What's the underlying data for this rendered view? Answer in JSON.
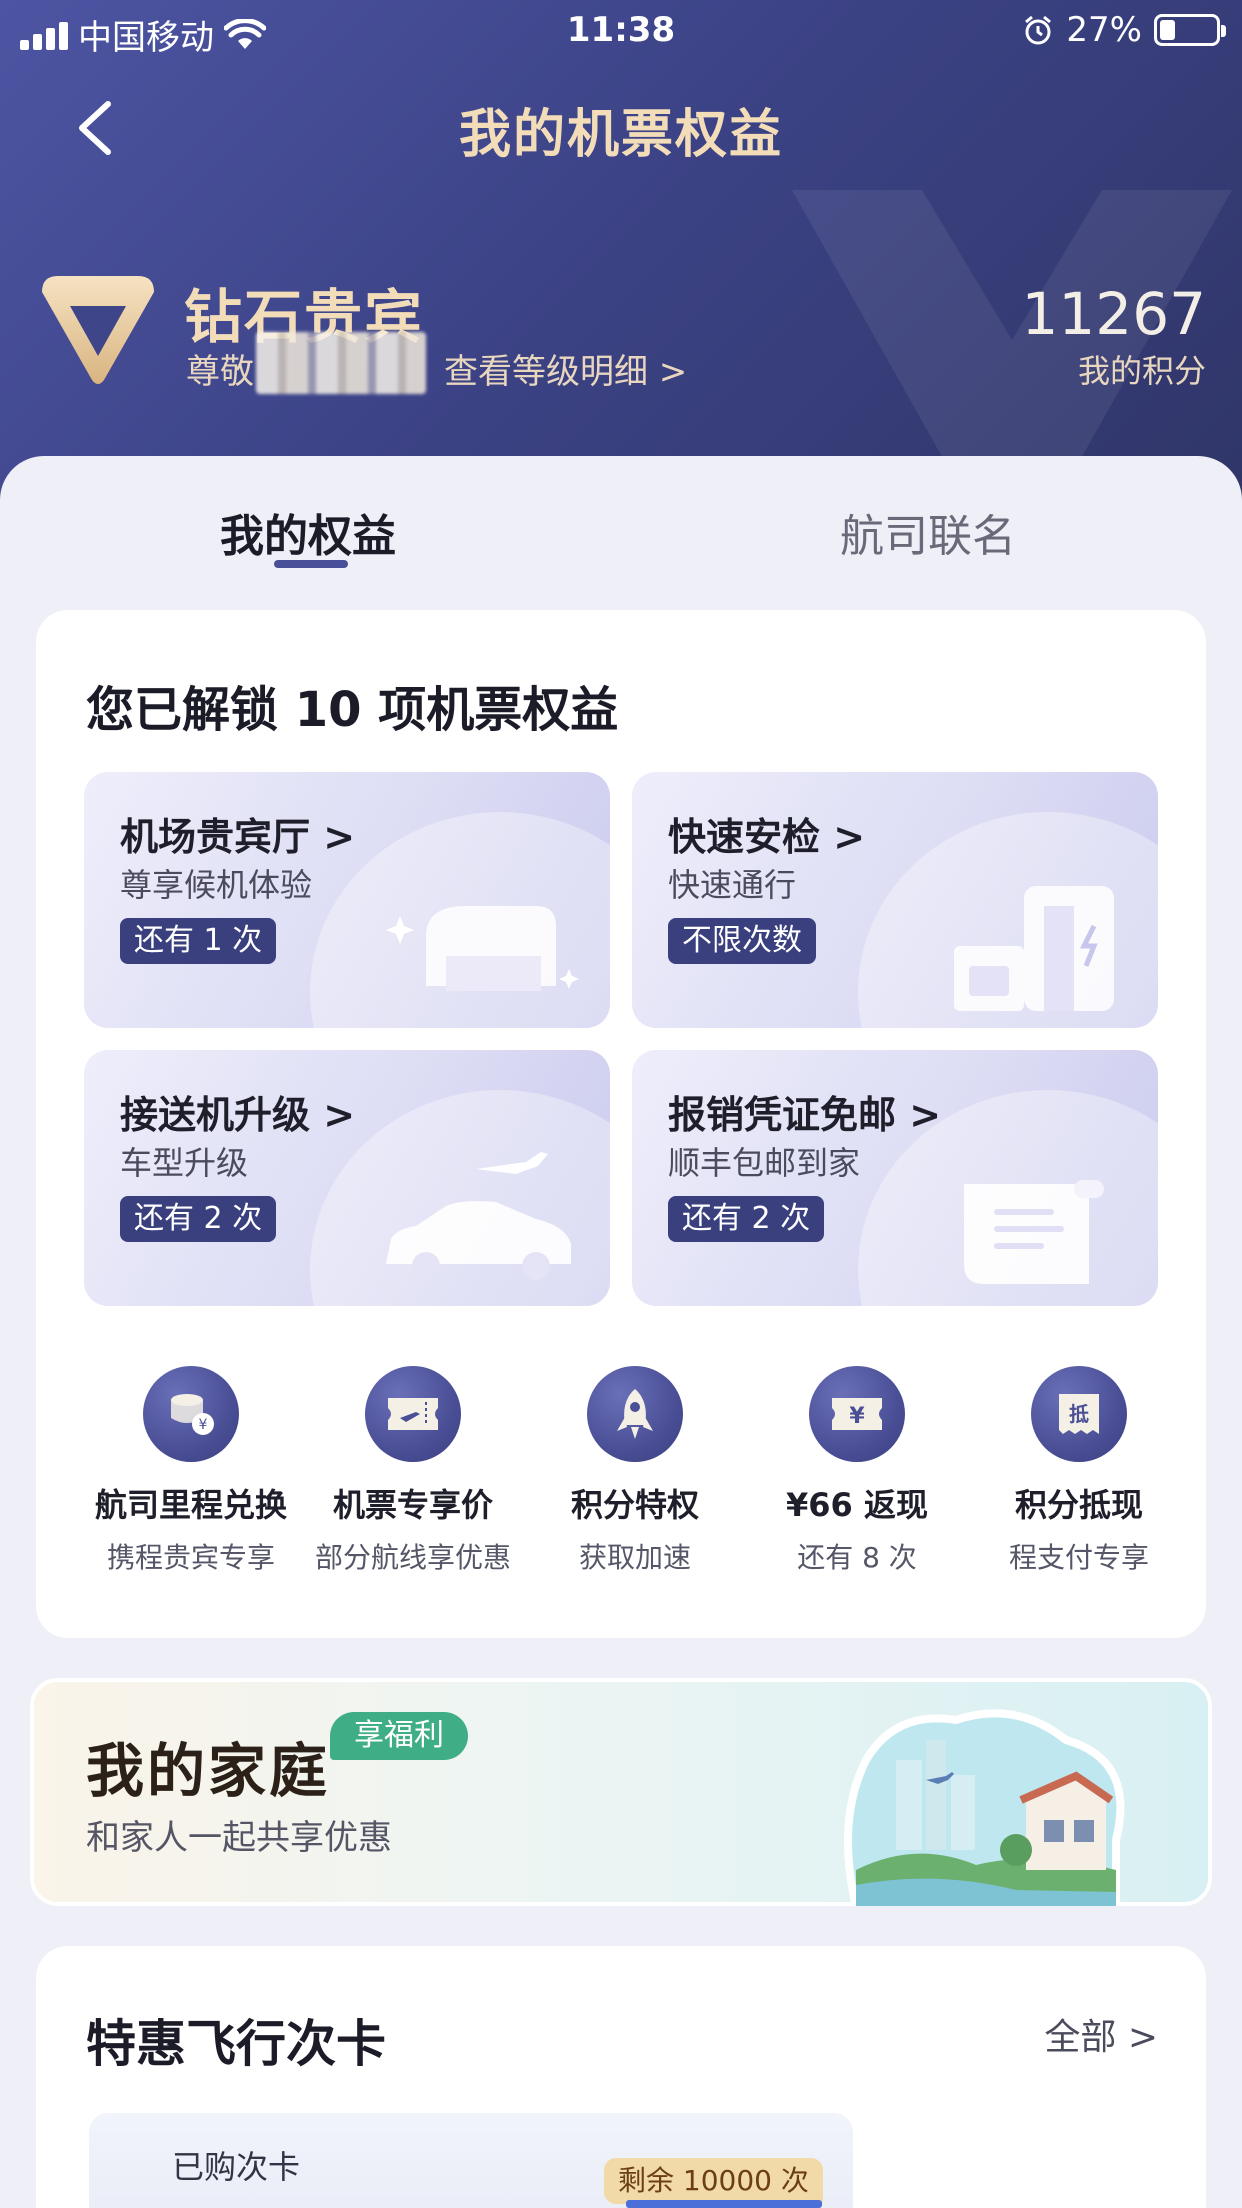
{
  "status_bar": {
    "carrier": "中国移动",
    "time": "11:38",
    "battery": "27%",
    "battery_level": 0.27
  },
  "nav": {
    "title": "我的机票权益"
  },
  "member": {
    "level": "钻石贵宾",
    "greeting": "尊敬",
    "level_link": "查看等级明细 >",
    "points": "11267",
    "points_label": "我的积分"
  },
  "tabs": [
    {
      "label": "我的权益",
      "active": true
    },
    {
      "label": "航司联名",
      "active": false
    }
  ],
  "benefits": {
    "title": "您已解锁 10 项机票权益",
    "cards": [
      {
        "title": "机场贵宾厅 >",
        "subtitle": "尊享候机体验",
        "badge": "还有 1 次",
        "icon": "lounge-chair-icon"
      },
      {
        "title": "快速安检 >",
        "subtitle": "快速通行",
        "badge": "不限次数",
        "icon": "security-gate-icon"
      },
      {
        "title": "接送机升级 >",
        "subtitle": "车型升级",
        "badge": "还有 2 次",
        "icon": "car-plane-icon"
      },
      {
        "title": "报销凭证免邮 >",
        "subtitle": "顺丰包邮到家",
        "badge": "还有 2 次",
        "icon": "receipt-icon"
      }
    ],
    "quick": [
      {
        "label": "航司里程兑换",
        "sub": "携程贵宾专享",
        "icon": "coins-icon"
      },
      {
        "label": "机票专享价",
        "sub": "部分航线享优惠",
        "icon": "ticket-icon"
      },
      {
        "label": "积分特权",
        "sub": "获取加速",
        "icon": "rocket-icon"
      },
      {
        "label": "¥66 返现",
        "sub": "还有 8 次",
        "icon": "yen-voucher-icon"
      },
      {
        "label": "积分抵现",
        "sub": "程支付专享",
        "icon": "offset-icon",
        "icon_text": "抵"
      }
    ]
  },
  "family": {
    "title": "我的家庭",
    "tag": "享福利",
    "subtitle": "和家人一起共享优惠"
  },
  "flight_cards": {
    "title": "特惠飞行次卡",
    "all_link": "全部 >",
    "purchased_label": "已购次卡",
    "remaining": "剩余 10000 次"
  },
  "colors": {
    "hero": "#3c4386",
    "gold": "#f3dcb8",
    "badge": "#3a3f7e",
    "accent_green": "#3fae86"
  }
}
